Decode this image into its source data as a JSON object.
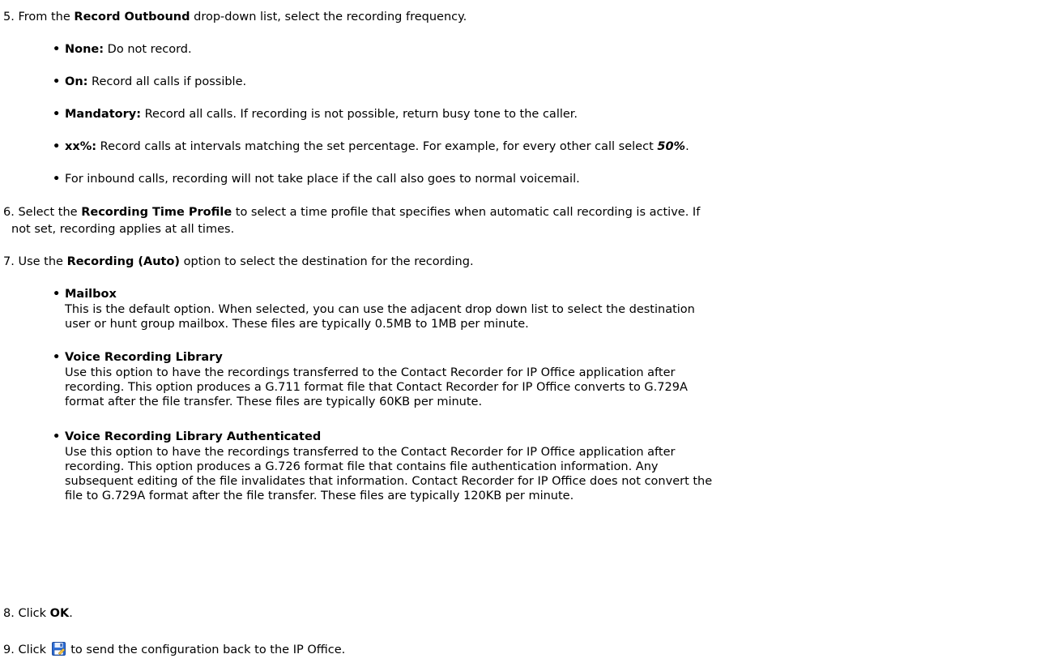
{
  "steps": [
    {
      "num": "5.",
      "pre": "From the ",
      "bold": "Record Outbound",
      "post": " drop-down list, select the recording frequency."
    },
    {
      "num": "6.",
      "pre": "Select the ",
      "bold": "Recording Time Profile",
      "post": " to select a time profile that specifies when automatic call recording is active. If",
      "line2": "not set, recording applies at all times."
    },
    {
      "num": "7.",
      "pre": "Use the ",
      "bold": "Recording (Auto)",
      "post": " option to select the destination for the recording."
    },
    {
      "num": "8.",
      "pre": "Click ",
      "bold": "OK",
      "post": "."
    },
    {
      "num": "9.",
      "pre": "Click ",
      "post": " to send the configuration back to the IP Office.",
      "icon": "save-disk-icon"
    }
  ],
  "frequency_options": [
    {
      "term": "None:",
      "text": " Do not record."
    },
    {
      "term": "On:",
      "text": " Record all calls if possible."
    },
    {
      "term": "Mandatory:",
      "text": " Record all calls. If recording is not possible, return busy tone to the caller."
    },
    {
      "term": "xx%:",
      "text": " Record calls at intervals matching the set percentage. For example, for every other call select ",
      "em": "50%",
      "tail": "."
    },
    {
      "term": "",
      "text": "For inbound calls, recording will not take place if the call also goes to normal voicemail."
    }
  ],
  "destinations": [
    {
      "term": "Mailbox",
      "lines": [
        "This is the default option. When selected, you can use the adjacent drop down list to select the destination",
        "user or hunt group mailbox. These files are typically 0.5MB to 1MB per minute."
      ]
    },
    {
      "term": "Voice Recording Library",
      "lines": [
        "Use this option to have the recordings transferred to the Contact Recorder for IP Office application after",
        "recording. This option produces a G.711 format file that Contact Recorder for IP Office converts to G.729A",
        "format after the file transfer. These files are typically 60KB per minute."
      ]
    },
    {
      "term": "Voice Recording Library Authenticated",
      "lines": [
        "Use this option to have the recordings transferred to the Contact Recorder for IP Office application after",
        "recording. This option produces a G.726 format file that contains file authentication information. Any",
        "subsequent editing of the file invalidates that information. Contact Recorder for IP Office does not convert the",
        "file to G.729A format after the file transfer. These files are typically 120KB per minute."
      ]
    }
  ]
}
